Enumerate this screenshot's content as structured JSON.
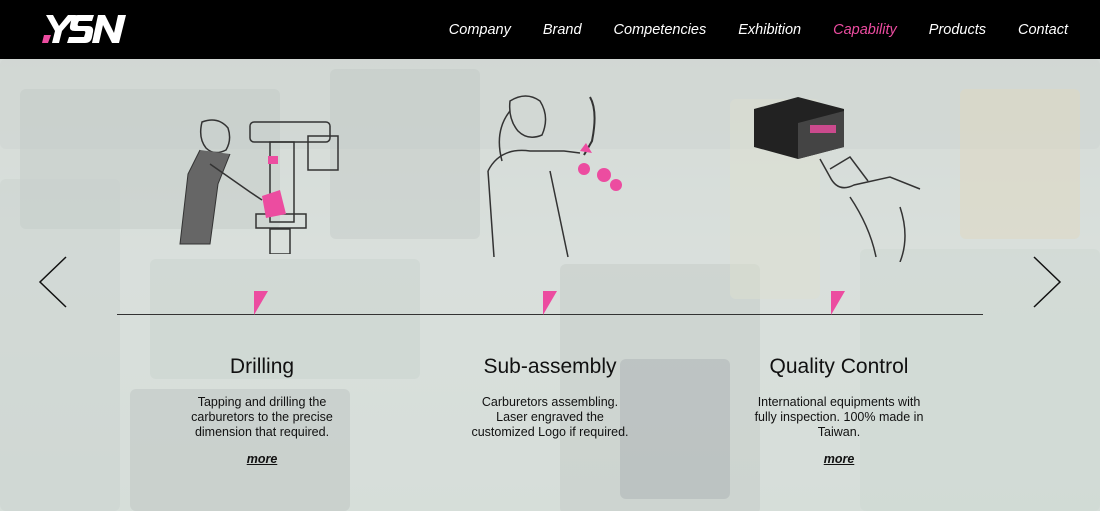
{
  "brand": {
    "logo_text": "YSN",
    "accent_color": "#ec4ca0"
  },
  "nav": {
    "items": [
      {
        "label": "Company"
      },
      {
        "label": "Brand"
      },
      {
        "label": "Competencies"
      },
      {
        "label": "Exhibition"
      },
      {
        "label": "Capability",
        "active": true
      },
      {
        "label": "Products"
      },
      {
        "label": "Contact"
      }
    ]
  },
  "carousel": {
    "prev_icon": "chevron-left-icon",
    "next_icon": "chevron-right-icon",
    "steps": [
      {
        "title": "Drilling",
        "description": "Tapping and drilling the carburetors to the precise dimension that required.",
        "more": "more",
        "icon": "drill-press-worker-illustration"
      },
      {
        "title": "Sub-assembly",
        "description": "Carburetors assembling. Laser engraved the customized Logo if required.",
        "more": "more",
        "icon": "assembly-worker-illustration"
      },
      {
        "title": "Quality Control",
        "description": "International equipments with fully inspection. 100% made in Taiwan.",
        "more": "more",
        "icon": "inspection-equipment-illustration"
      }
    ]
  }
}
